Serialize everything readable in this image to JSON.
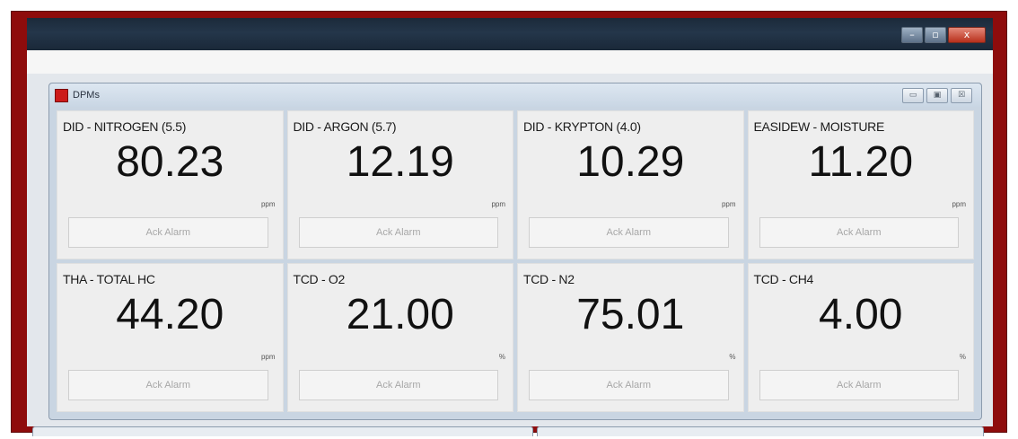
{
  "outer_window": {
    "controls": {
      "minimize": "–",
      "maximize": "▫",
      "close": "x"
    }
  },
  "mdi_window": {
    "title": "DPMs",
    "controls": {
      "minimize": "▭",
      "restore": "▣",
      "close": "☒"
    }
  },
  "tiles": [
    {
      "label": "DID - NITROGEN (5.5)",
      "value": "80.23",
      "unit": "ppm",
      "ack_label": "Ack Alarm"
    },
    {
      "label": "DID - ARGON (5.7)",
      "value": "12.19",
      "unit": "ppm",
      "ack_label": "Ack Alarm"
    },
    {
      "label": "DID - KRYPTON (4.0)",
      "value": "10.29",
      "unit": "ppm",
      "ack_label": "Ack Alarm"
    },
    {
      "label": "EASIDEW - MOISTURE",
      "value": "11.20",
      "unit": "ppm",
      "ack_label": "Ack Alarm"
    },
    {
      "label": "THA - TOTAL HC",
      "value": "44.20",
      "unit": "ppm",
      "ack_label": "Ack Alarm"
    },
    {
      "label": "TCD - O2",
      "value": "21.00",
      "unit": "%",
      "ack_label": "Ack Alarm"
    },
    {
      "label": "TCD - N2",
      "value": "75.01",
      "unit": "%",
      "ack_label": "Ack Alarm"
    },
    {
      "label": "TCD - CH4",
      "value": "4.00",
      "unit": "%",
      "ack_label": "Ack Alarm"
    }
  ],
  "colors": {
    "frame": "#8e0c0c",
    "titlebar": "#1b2a3a",
    "tile_background": "#eeeeee",
    "app_icon": "#cc1a1a"
  }
}
